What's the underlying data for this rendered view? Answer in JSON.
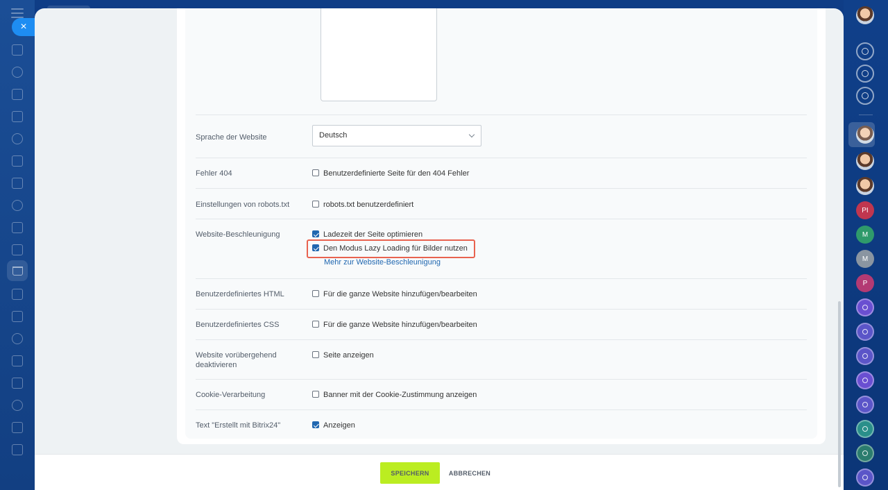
{
  "left_sidebar": {
    "close_glyph": "×",
    "icons": [
      "home-icon",
      "crm-icon",
      "tasks-icon",
      "contacts-icon",
      "documents-icon",
      "feed-icon",
      "board-icon",
      "calendar-icon",
      "checklist-icon",
      "analytics-icon",
      "shop-icon",
      "filter-icon",
      "marketing-icon",
      "sign-icon",
      "box-icon",
      "chat-icon",
      "group-icon",
      "smile-icon",
      "more-icon"
    ]
  },
  "right_sidebar": {
    "items": [
      {
        "type": "avatar",
        "name": "user-avatar"
      },
      {
        "type": "outline",
        "name": "notifications-icon"
      },
      {
        "type": "outline",
        "name": "copilot-icon"
      },
      {
        "type": "outline",
        "name": "messages-icon"
      },
      {
        "type": "avatar",
        "name": "contact-avatar-1"
      },
      {
        "type": "avatar",
        "name": "contact-avatar-2"
      },
      {
        "type": "avatar",
        "name": "contact-avatar-3"
      },
      {
        "type": "initials",
        "text": "PI",
        "color": "#c0364f"
      },
      {
        "type": "initials",
        "text": "M",
        "color": "#2f9a6b"
      },
      {
        "type": "initials",
        "text": "M",
        "color": "#8a95a1"
      },
      {
        "type": "initials",
        "text": "P",
        "color": "#b33a73"
      },
      {
        "type": "app",
        "color": "#6a4fd1"
      },
      {
        "type": "app",
        "color": "#5b55c8"
      },
      {
        "type": "app",
        "color": "#5b55c8"
      },
      {
        "type": "app",
        "color": "#6a4fd1"
      },
      {
        "type": "app",
        "color": "#5b55c8"
      },
      {
        "type": "app",
        "color": "#2a8f8a"
      },
      {
        "type": "app",
        "color": "#2b7c6e"
      },
      {
        "type": "app",
        "color": "#5b55c8"
      }
    ]
  },
  "settings": {
    "language": {
      "label": "Sprache der Website",
      "value": "Deutsch"
    },
    "error404": {
      "label": "Fehler 404",
      "option": "Benutzerdefinierte Seite für den 404 Fehler",
      "checked": false
    },
    "robots": {
      "label": "Einstellungen von robots.txt",
      "option": "robots.txt benutzerdefiniert",
      "checked": false
    },
    "acceleration": {
      "label": "Website-Beschleunigung",
      "options": [
        {
          "text": "Ladezeit der Seite optimieren",
          "checked": true
        },
        {
          "text": "Den Modus Lazy Loading für Bilder nutzen",
          "checked": true
        }
      ],
      "link": "Mehr zur Website-Beschleunigung"
    },
    "custom_html": {
      "label": "Benutzerdefiniertes HTML",
      "option": "Für die ganze Website hinzufügen/bearbeiten",
      "checked": false
    },
    "custom_css": {
      "label": "Benutzerdefiniertes CSS",
      "option": "Für die ganze Website hinzufügen/bearbeiten",
      "checked": false
    },
    "deactivate": {
      "label": "Website vorübergehend deaktivieren",
      "option": "Seite anzeigen",
      "checked": false
    },
    "cookies": {
      "label": "Cookie-Verarbeitung",
      "option": "Banner mit der Cookie-Zustimmung anzeigen",
      "checked": false
    },
    "made_with": {
      "label": "Text \"Erstellt mit Bitrix24\"",
      "option": "Anzeigen",
      "checked": true
    }
  },
  "footer": {
    "save_label": "SPEICHERN",
    "cancel_label": "ABBRECHEN"
  },
  "colors": {
    "accent": "#2067b0",
    "save_button": "#bbed21",
    "highlight": "#e8624f"
  }
}
